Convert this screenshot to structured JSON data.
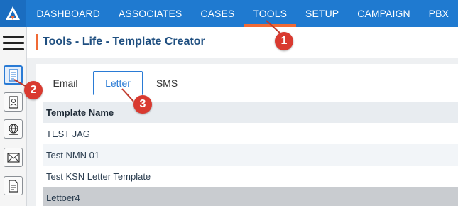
{
  "nav": {
    "items": [
      {
        "label": "DASHBOARD",
        "active": false
      },
      {
        "label": "ASSOCIATES",
        "active": false
      },
      {
        "label": "CASES",
        "active": false
      },
      {
        "label": "TOOLS",
        "active": true
      },
      {
        "label": "SETUP",
        "active": false
      },
      {
        "label": "CAMPAIGN",
        "active": false
      },
      {
        "label": "PBX",
        "active": false
      }
    ],
    "accent_color": "#f06a35",
    "bar_color": "#1f7ad0"
  },
  "left_rail": {
    "icons": [
      "menu-icon",
      "document-template-icon",
      "address-book-icon",
      "web-icon",
      "mail-icon",
      "document-export-icon"
    ]
  },
  "page": {
    "title": "Tools - Life - Template Creator"
  },
  "tabs": [
    {
      "label": "Email",
      "active": false
    },
    {
      "label": "Letter",
      "active": true
    },
    {
      "label": "SMS",
      "active": false
    }
  ],
  "table": {
    "header": "Template Name",
    "rows": [
      "TEST JAG",
      "Test NMN 01",
      "Test KSN Letter Template",
      "Lettoer4"
    ]
  },
  "callouts": [
    "1",
    "2",
    "3"
  ]
}
